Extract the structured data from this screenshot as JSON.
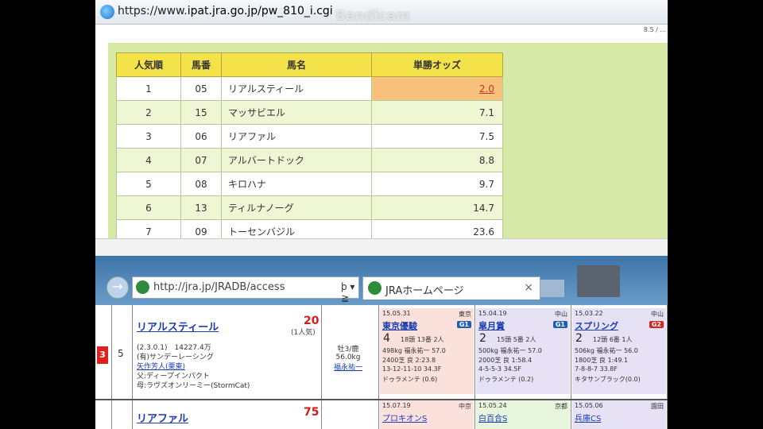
{
  "top_window": {
    "url_prefix": "https://www.",
    "url_rest": "ipat.jra.go.jp/pw_810_i.cgi",
    "watermark": "Bandicam",
    "corner_text": "8.5 / ..."
  },
  "odds_table": {
    "headers": [
      "人気順",
      "馬番",
      "馬名",
      "単勝オッズ"
    ],
    "rows": [
      {
        "rank": "1",
        "num": "05",
        "name": "リアルスティール",
        "odds": "2.0"
      },
      {
        "rank": "2",
        "num": "15",
        "name": "マッサビエル",
        "odds": "7.1"
      },
      {
        "rank": "3",
        "num": "06",
        "name": "リアファル",
        "odds": "7.5"
      },
      {
        "rank": "4",
        "num": "07",
        "name": "アルバートドック",
        "odds": "8.8"
      },
      {
        "rank": "5",
        "num": "08",
        "name": "キロハナ",
        "odds": "9.7"
      },
      {
        "rank": "6",
        "num": "13",
        "name": "ティルナノーグ",
        "odds": "14.7"
      },
      {
        "rank": "7",
        "num": "09",
        "name": "トーセンバジル",
        "odds": "23.6"
      }
    ]
  },
  "bottom_window": {
    "address": "http://jra.jp/JRADB/access",
    "address_tools": "ϸ ▾ ≧ C",
    "tab_title": "JRAホームページ",
    "tab_close": "×",
    "nav_arrow": "→"
  },
  "horse": {
    "waku": "3",
    "umaban": "5",
    "name": "リアルスティール",
    "odds": "20",
    "rank": "(1人気)",
    "info": [
      "(2.3.0.1)　14227.4万",
      "(有)サンデーレーシング",
      "矢作芳人(栗東)",
      "父:ディープインパクト",
      "母:ラヴズオンリーミー(StormCat)"
    ],
    "sex_age_weight": "牡3/鹿",
    "carried": "56.0kg",
    "jockey": "福永祐一"
  },
  "past_races": [
    {
      "date": "15.05.31",
      "venue": "東京",
      "name": "東京優駿",
      "grade": "G1",
      "place": "4",
      "l1": "18頭 13番 2人",
      "l2": "498kg 福永祐一 57.0",
      "l3": "2400芝 良 2:23.8",
      "l4": "13-12-11-10 34.3F",
      "l5": "ドゥラメンテ (0.6)"
    },
    {
      "date": "15.04.19",
      "venue": "中山",
      "name": "皐月賞",
      "grade": "G1",
      "place": "2",
      "l1": "15頭 5番 2人",
      "l2": "500kg 福永祐一 57.0",
      "l3": "2000芝 良 1:58.4",
      "l4": "4-5-5-3 34.5F",
      "l5": "ドゥラメンテ (0.2)"
    },
    {
      "date": "15.03.22",
      "venue": "中山",
      "name": "スプリング",
      "grade": "G2",
      "place": "2",
      "l1": "12頭 6番 1人",
      "l2": "506kg 福永祐一 56.0",
      "l3": "1800芝 良 1:49.1",
      "l4": "7-8-8-7 33.8F",
      "l5": "キタサンブラック(0.0)"
    }
  ],
  "second_row": {
    "name": "リアファル",
    "odds": "75",
    "races": [
      {
        "date": "15.07.19",
        "venue": "中京",
        "name": "プロキオンS"
      },
      {
        "date": "15.05.24",
        "venue": "京都",
        "name": "白百合S"
      },
      {
        "date": "15.05.06",
        "venue": "園田",
        "name": "兵庫CS"
      }
    ]
  },
  "colors": {
    "odds_red": "#d43a2c",
    "odds_blue": "#2a6fb4",
    "highlight": "#f8c27c",
    "header_yellow": "#f4e24a"
  }
}
